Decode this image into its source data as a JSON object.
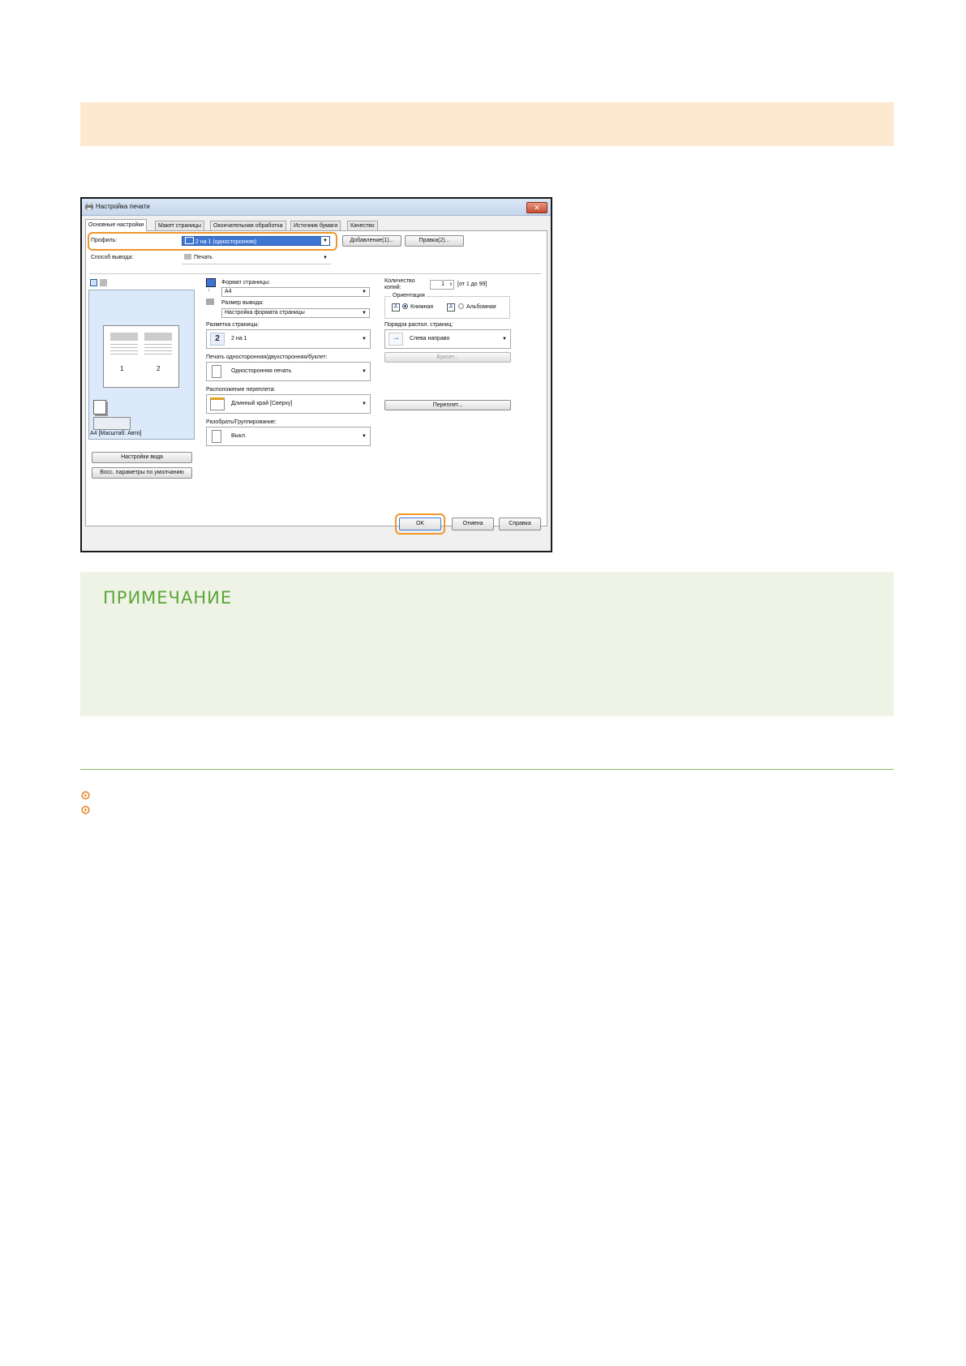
{
  "dialog": {
    "title": "Настройка печати",
    "tabs": [
      "Основные настройки",
      "Макет страницы",
      "Окончательная обработка",
      "Источник бумаги",
      "Качество"
    ],
    "profile": {
      "label": "Профиль:",
      "value": "2 на 1 (односторонняя)",
      "add_button": "Добавление(1)...",
      "edit_button": "Правка(2)..."
    },
    "output": {
      "label": "Способ вывода:",
      "value": "Печать"
    },
    "preview": {
      "page_numbers": [
        "1",
        "2"
      ],
      "caption": "A4 [Масштаб: Авто]"
    },
    "left_buttons": {
      "view_settings": "Настройки вида",
      "restore_defaults": "Восс. параметры по умолчанию"
    },
    "page_size": {
      "label": "Формат страницы:",
      "value": "A4"
    },
    "output_size": {
      "label": "Размер вывода:",
      "value": "Настройка формата страницы"
    },
    "layout": {
      "label": "Разметка страницы:",
      "icon_number": "2",
      "value": "2 на 1"
    },
    "duplex": {
      "label": "Печать односторонняя/двухсторонняя/буклет:",
      "value": "Односторонняя печать"
    },
    "binding": {
      "label": "Расположение переплета:",
      "value": "Длинный край [Сверху]"
    },
    "collate": {
      "label": "Разобрать/Группирование:",
      "value": "Выкл."
    },
    "copies": {
      "label_line1": "Количество",
      "label_line2": "копий:",
      "value": "1",
      "range": "[от 1 до 99]"
    },
    "orientation": {
      "group_label": "Ориентация",
      "portrait": "Книжная",
      "landscape": "Альбомная",
      "glyph": "A"
    },
    "page_order": {
      "label": "Порядок распол. страниц:",
      "value": "Слева направо"
    },
    "booklet_button": "Буклет...",
    "gutter_button": "Переплет...",
    "footer": {
      "ok": "OK",
      "cancel": "Отмена",
      "help": "Справка"
    }
  },
  "note": {
    "title": "ПРИМЕЧАНИЕ"
  },
  "colors": {
    "accent_orange": "#f0962a",
    "note_green": "#5aa638",
    "band_top": "#fde9cf",
    "note_bg": "#eef3e6"
  }
}
